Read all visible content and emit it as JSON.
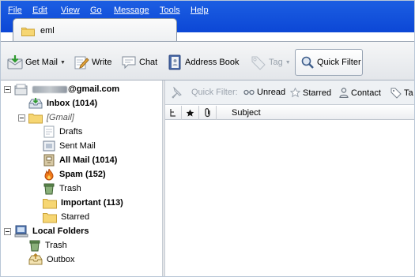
{
  "menubar": {
    "items": [
      "File",
      "Edit",
      "View",
      "Go",
      "Message",
      "Tools",
      "Help"
    ]
  },
  "tabs": [
    {
      "label": "eml"
    }
  ],
  "toolbar": {
    "get_mail": "Get Mail",
    "write": "Write",
    "chat": "Chat",
    "address_book": "Address Book",
    "tag": "Tag",
    "quick_filter": "Quick Filter"
  },
  "folders": {
    "account": "@gmail.com",
    "inbox": "Inbox (1014)",
    "gmail": "[Gmail]",
    "drafts": "Drafts",
    "sent": "Sent Mail",
    "all_mail": "All Mail (1014)",
    "spam": "Spam (152)",
    "trash": "Trash",
    "important": "Important (113)",
    "starred": "Starred",
    "local_folders": "Local Folders",
    "local_trash": "Trash",
    "outbox": "Outbox"
  },
  "quick_filter_bar": {
    "label": "Quick Filter:",
    "unread": "Unread",
    "starred": "Starred",
    "contact": "Contact",
    "tags": "Ta"
  },
  "columns": {
    "subject": "Subject"
  },
  "colors": {
    "menubar": "#0c47d6",
    "folder_yellow": "#f5d76e",
    "accent_blue": "#1c5ee2"
  }
}
